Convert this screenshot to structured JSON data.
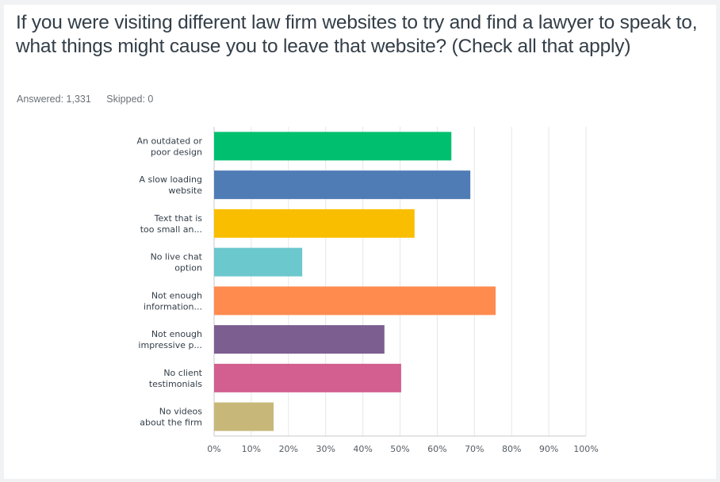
{
  "question": {
    "title": "If you were visiting different law firm websites to try and find a lawyer to speak to, what things might cause you to leave that website? (Check all that apply)",
    "answered": "Answered: 1,331",
    "skipped": "Skipped: 0"
  },
  "chart_data": {
    "type": "bar",
    "orientation": "horizontal",
    "title": "If you were visiting different law firm websites to try and find a lawyer to speak to, what things might cause you to leave that website? (Check all that apply)",
    "xlabel": "",
    "ylabel": "",
    "xlim": [
      0,
      100
    ],
    "grid": true,
    "categories": [
      [
        "An outdated or",
        "poor design"
      ],
      [
        "A slow loading",
        "website"
      ],
      [
        "Text that is",
        "too small an..."
      ],
      [
        "No live chat",
        "option"
      ],
      [
        "Not enough",
        "information..."
      ],
      [
        "Not enough",
        "impressive p..."
      ],
      [
        "No client",
        "testimonials"
      ],
      [
        "No videos",
        "about the firm"
      ]
    ],
    "values": [
      63.8,
      68.9,
      53.9,
      23.7,
      75.7,
      45.8,
      50.3,
      16.0
    ],
    "colors": [
      "#00bf6f",
      "#507cb6",
      "#f9be00",
      "#6bc8cd",
      "#ff8b4f",
      "#7d5e90",
      "#d25f90",
      "#c7b879"
    ],
    "ticks": [
      "0%",
      "10%",
      "20%",
      "30%",
      "40%",
      "50%",
      "60%",
      "70%",
      "80%",
      "90%",
      "100%"
    ]
  }
}
